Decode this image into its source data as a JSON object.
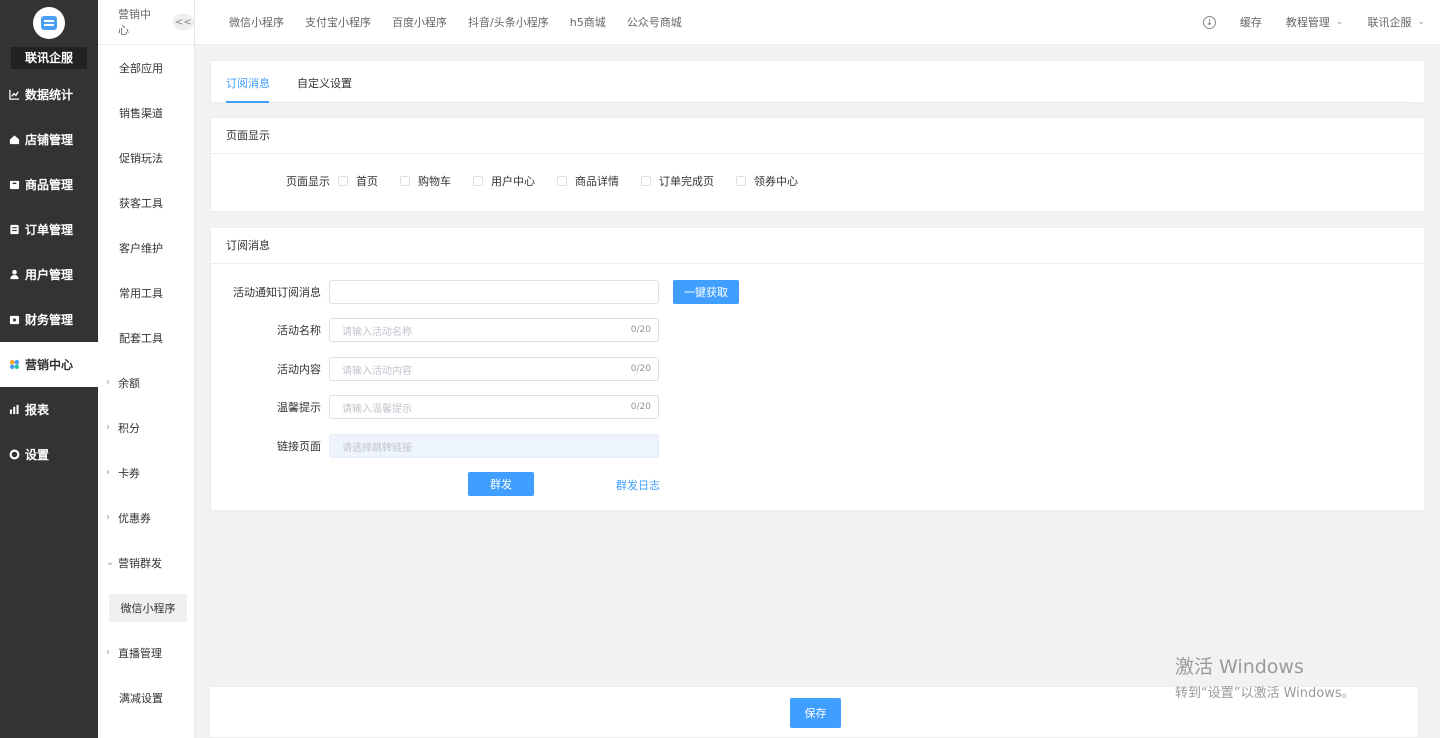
{
  "sidebar": {
    "brand": "联讯企服",
    "items": [
      {
        "label": "数据统计",
        "icon": "chart-line-icon"
      },
      {
        "label": "店铺管理",
        "icon": "home-icon"
      },
      {
        "label": "商品管理",
        "icon": "box-icon"
      },
      {
        "label": "订单管理",
        "icon": "order-icon"
      },
      {
        "label": "用户管理",
        "icon": "user-icon"
      },
      {
        "label": "财务管理",
        "icon": "wallet-icon"
      },
      {
        "label": "营销中心",
        "icon": "marketing-icon",
        "active": true
      },
      {
        "label": "报表",
        "icon": "bar-chart-icon"
      },
      {
        "label": "设置",
        "icon": "gear-icon"
      }
    ]
  },
  "sub_sidebar": {
    "title": "营销中心",
    "collapse": "<<",
    "items": [
      "全部应用",
      "销售渠道",
      "促销玩法",
      "获客工具",
      "客户维护",
      "常用工具",
      "配套工具"
    ],
    "groups": [
      "余额",
      "积分",
      "卡券",
      "优惠券",
      "营销群发"
    ],
    "active_child": "微信小程序",
    "after_groups": [
      "直播管理"
    ],
    "last_item": "满减设置"
  },
  "topbar": {
    "tabs": [
      "微信小程序",
      "支付宝小程序",
      "百度小程序",
      "抖音/头条小程序",
      "h5商城",
      "公众号商城"
    ],
    "cache": "缓存",
    "tutorial": "教程管理",
    "account": "联讯企服"
  },
  "content_tabs": {
    "active": "订阅消息",
    "other": "自定义设置"
  },
  "page_display": {
    "title": "页面显示",
    "label": "页面显示",
    "options": [
      "首页",
      "购物车",
      "用户中心",
      "商品详情",
      "订单完成页",
      "领券中心"
    ]
  },
  "subscribe": {
    "title": "订阅消息",
    "fields": {
      "notify_label": "活动通知订阅消息",
      "fetch_btn": "一键获取",
      "name_label": "活动名称",
      "name_placeholder": "请输入活动名称",
      "name_count": "0/20",
      "content_label": "活动内容",
      "content_placeholder": "请输入活动内容",
      "content_count": "0/20",
      "tip_label": "温馨提示",
      "tip_placeholder": "请输入温馨提示",
      "tip_count": "0/20",
      "link_label": "链接页面",
      "link_placeholder": "请选择跳转链接"
    },
    "send_btn": "群发",
    "log_link": "群发日志"
  },
  "footer": {
    "save": "保存"
  },
  "watermark": {
    "line1": "激活 Windows",
    "line2": "转到“设置”以激活 Windows。"
  },
  "colors": {
    "accent": "#409eff",
    "sidebar": "#333333"
  }
}
